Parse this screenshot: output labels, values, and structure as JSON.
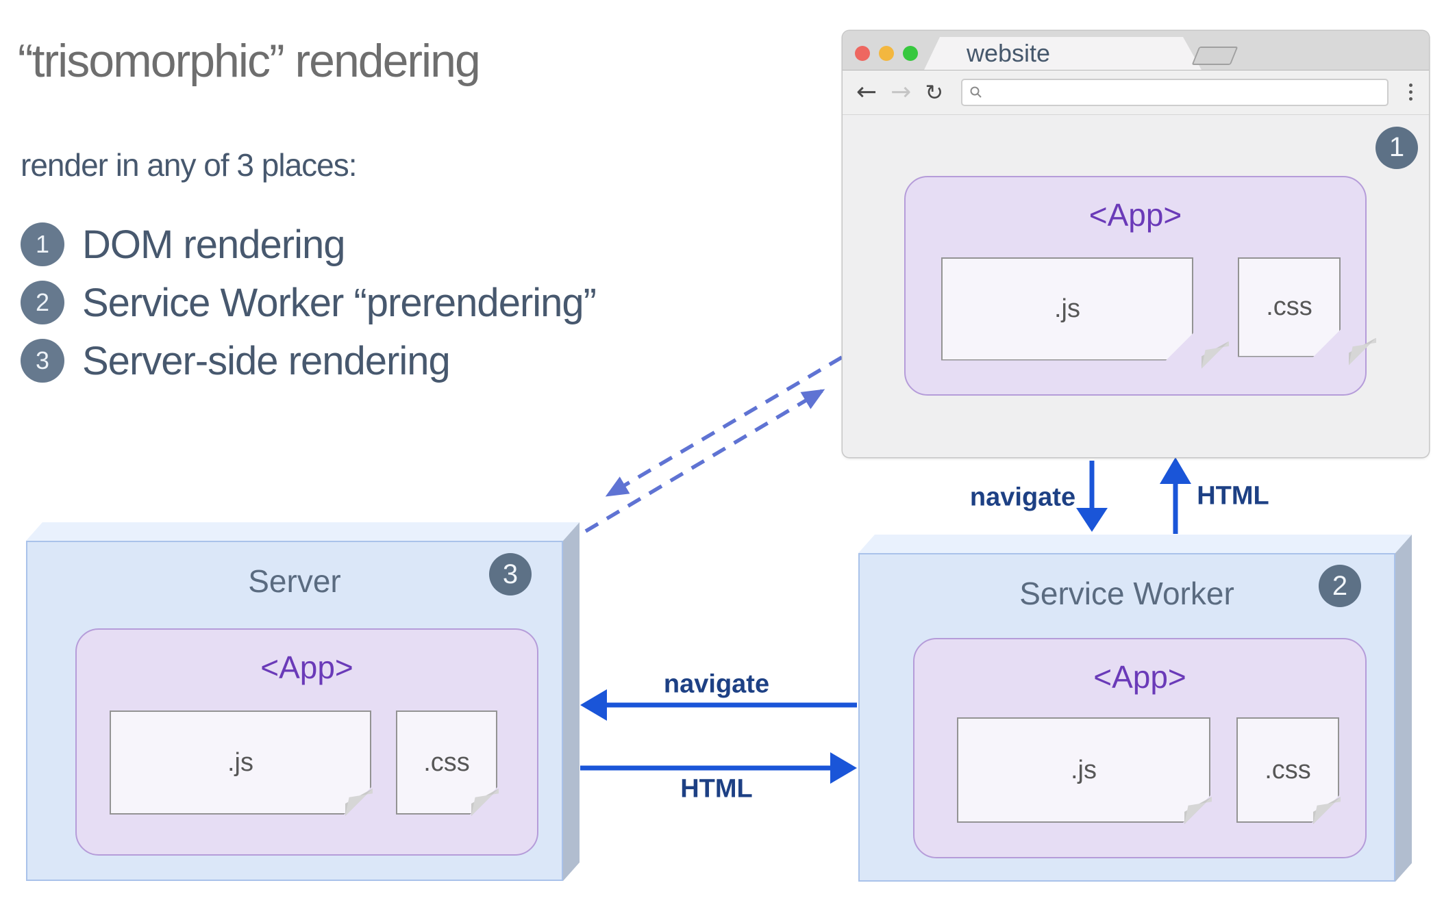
{
  "heading": {
    "title": "“trisomorphic” rendering",
    "subtitle": "render in any of 3 places:"
  },
  "legend": [
    {
      "number": "1",
      "label": "DOM rendering"
    },
    {
      "number": "2",
      "label": "Service Worker “prerendering”"
    },
    {
      "number": "3",
      "label": "Server-side rendering"
    }
  ],
  "browser": {
    "tab_title": "website",
    "url_value": "",
    "badge": "1",
    "app": {
      "label": "<App>",
      "js": ".js",
      "css": ".css"
    }
  },
  "server": {
    "title": "Server",
    "badge": "3",
    "app": {
      "label": "<App>",
      "js": ".js",
      "css": ".css"
    }
  },
  "service_worker": {
    "title": "Service Worker",
    "badge": "2",
    "app": {
      "label": "<App>",
      "js": ".js",
      "css": ".css"
    }
  },
  "arrows": {
    "browser_navigate": "navigate",
    "browser_html": "HTML",
    "server_navigate": "navigate",
    "server_html": "HTML"
  },
  "colors": {
    "arrow_blue": "#1a55d8",
    "arrow_label": "#1d4084",
    "dashed_arrow": "#5f73d3",
    "badge_bg": "#5d7186",
    "legend_badge_bg": "#66798e",
    "box_front": "#dbe7f8",
    "box_top": "#e9f1fd",
    "box_side": "#b1bdcf",
    "box_edge": "#a9c2ea",
    "app_fill": "#e6ddf4",
    "app_border": "#b59cd9",
    "app_text": "#6a3ab8",
    "card_fill": "#f7f5fb",
    "card_border": "#939393",
    "card_fold": "#d6d6d6",
    "card_text": "#575757",
    "title_gray": "#6e6e6e",
    "slate_text": "#47586e",
    "box_title": "#5a6b80",
    "tab_text": "#46586c",
    "light_red": "#ee6760",
    "light_yellow": "#f3b73f",
    "light_green": "#37c83f"
  }
}
